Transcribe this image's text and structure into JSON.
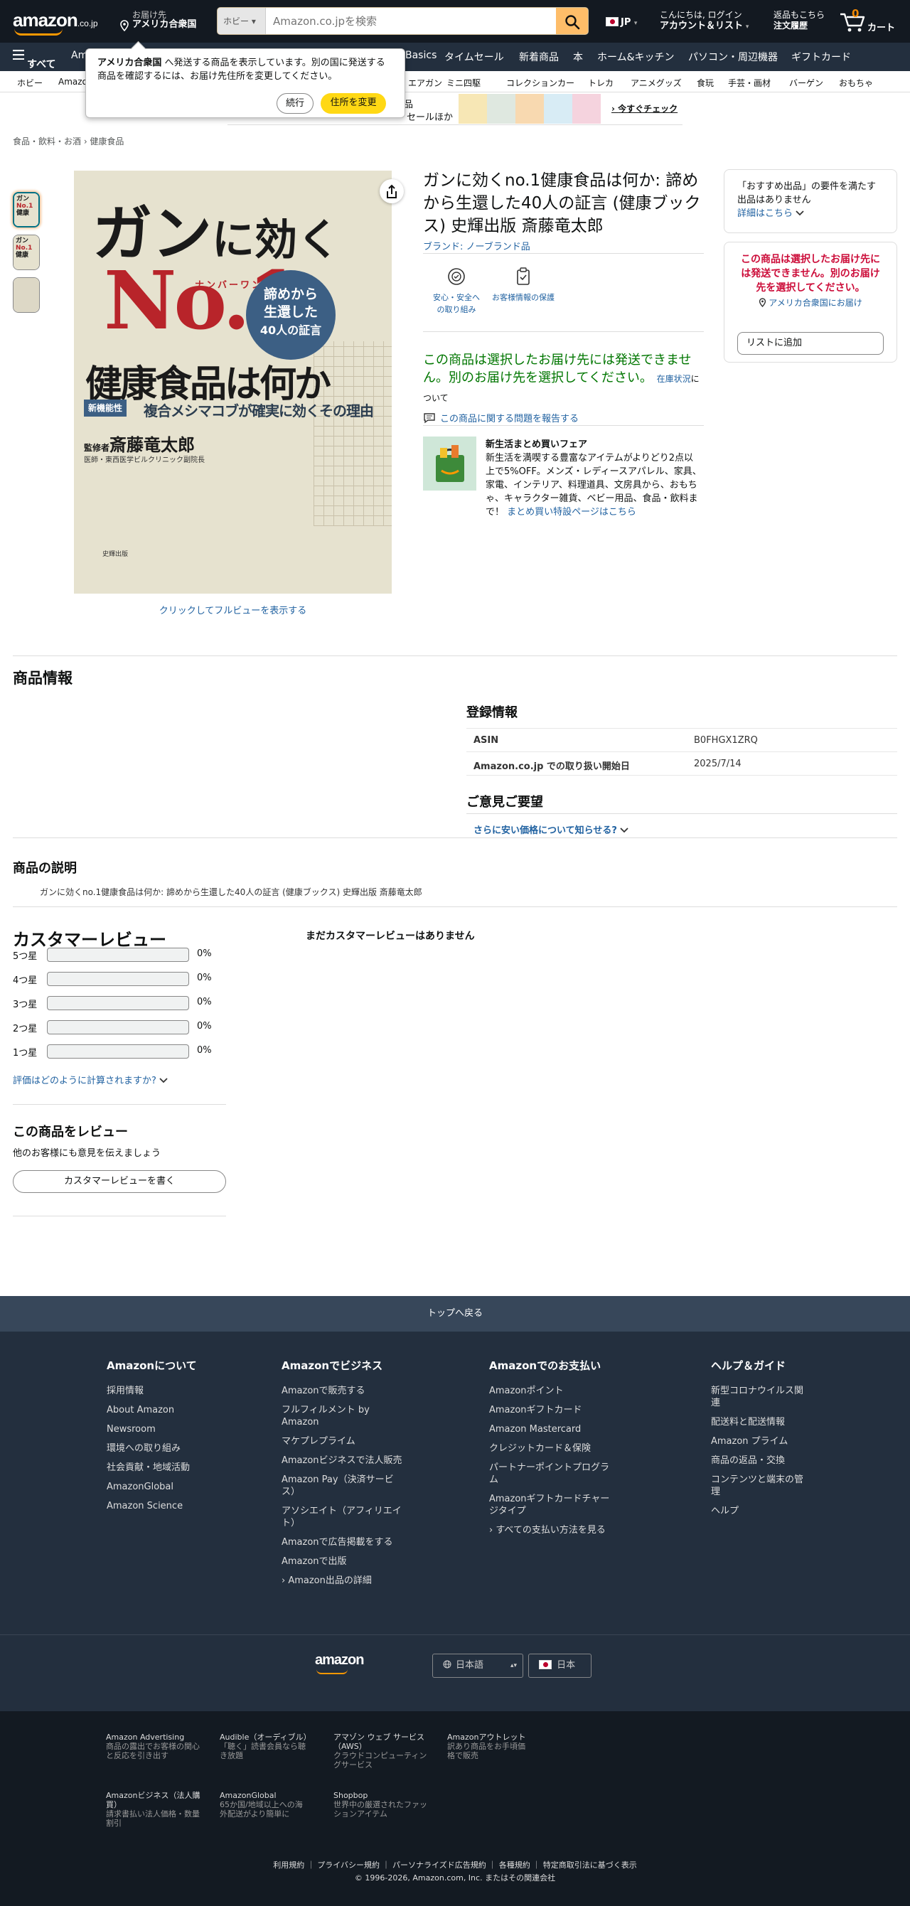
{
  "header": {
    "logo_text": "amazon",
    "logo_suffix": ".co.jp",
    "deliver_label": "お届け先",
    "deliver_to": "アメリカ合衆国",
    "search_category": "ホビー",
    "search_placeholder": "Amazon.co.jpを検索",
    "lang": "JP",
    "account_line1": "こんにちは, ログイン",
    "account_line2": "アカウント＆リスト",
    "orders_line1": "返品もこちら",
    "orders_line2": "注文履歴",
    "cart_count": "0",
    "cart_label": "カート"
  },
  "nav_main": [
    "すべて",
    "Am",
    "Basics",
    "タイムセール",
    "新着商品",
    "本",
    "ホーム&キッチン",
    "パソコン・周辺機器",
    "ギフトカード"
  ],
  "nav_sub": [
    "ホビー",
    "Amazo",
    "エアガン",
    "ミニ四駆",
    "コレクションカー",
    "トレカ",
    "アニメグッズ",
    "食玩",
    "手芸・画材",
    "バーゲン",
    "おもちゃ"
  ],
  "banner": {
    "text_a": "品",
    "text_b": "セールほか",
    "cta": "今すぐチェック"
  },
  "popover": {
    "country": "アメリカ合衆国",
    "text": " へ発送する商品を表示しています。別の国に発送する商品を確認するには、お届け先住所を変更してください。",
    "continue": "続行",
    "change": "住所を変更"
  },
  "breadcrumb": "食品・飲料・お酒 › 健康食品",
  "product": {
    "cover": {
      "title_a": "ガン",
      "title_b": "に効く",
      "ruby": "ナンバーワン",
      "no1": "No.1",
      "title_c": "健康食品は何か",
      "seal": [
        "諦めから",
        "生還した",
        "40人の証言"
      ],
      "tag": "新機能性",
      "sub": "複合メシマコブが確実に効くその理由",
      "sup_label": "監修者",
      "author": "斎藤竜太郎",
      "author_title": "医師・東西医学ビルクリニック副院長",
      "publisher": "史輝出版"
    },
    "title": "ガンに効くno.1健康食品は何か: 諦めから生還した40人の証言 (健康ブックス) 史輝出版 斎藤竜太郎",
    "brand": "ブランド: ノーブランド品",
    "fullview": "クリックしてフルビューを表示する",
    "features": [
      {
        "label": "安心・安全への取り組み"
      },
      {
        "label": "お客様情報の保護"
      }
    ],
    "unavailable": "この商品は選択したお届け先には発送できません。別のお届け先を選択してください。",
    "stock_link": "在庫状況",
    "stock_tail": "について",
    "report": "この商品に関する問題を報告する",
    "fair_title": "新生活まとめ買いフェア",
    "fair_text": "新生活を満喫する豊富なアイテムがよりどり2点以上で5%OFF。メンズ・レディースアパレル、家具、家電、インテリア、料理道具、文房具から、おもちゃ、キャラクター雑貨、ベビー用品、食品・飲料まで！",
    "fair_link": "まとめ買い特設ページはこちら"
  },
  "buybox": {
    "rec_text": "「おすすめ出品」の要件を満たす出品はありません",
    "rec_link": "詳細はこちら",
    "err_text": "この商品は選択したお届け先には発送できません。別のお届け先を選択してください。",
    "loc": "アメリカ合衆国にお届け",
    "list_btn": "リストに追加"
  },
  "info": {
    "heading": "商品情報",
    "reg_heading": "登録情報",
    "rows": [
      {
        "k": "ASIN",
        "v": "B0FHGX1ZRQ"
      },
      {
        "k": "Amazon.co.jp での取り扱い開始日",
        "v": "2025/7/14"
      }
    ],
    "feedback_heading": "ご意見ご要望",
    "feedback_link": "さらに安い価格について知らせる?"
  },
  "description": {
    "heading": "商品の説明",
    "text": "ガンに効くno.1健康食品は何か: 諦めから生還した40人の証言 (健康ブックス) 史輝出版 斎藤竜太郎"
  },
  "reviews": {
    "heading": "カスタマーレビュー",
    "none": "まだカスタマーレビューはありません",
    "rows": [
      {
        "label": "5つ星",
        "pct": "0%"
      },
      {
        "label": "4つ星",
        "pct": "0%"
      },
      {
        "label": "3つ星",
        "pct": "0%"
      },
      {
        "label": "2つ星",
        "pct": "0%"
      },
      {
        "label": "1つ星",
        "pct": "0%"
      }
    ],
    "how": "評価はどのように計算されますか?",
    "write_heading": "この商品をレビュー",
    "write_sub": "他のお客様にも意見を伝えましょう",
    "write_btn": "カスタマーレビューを書く"
  },
  "footer": {
    "back_top": "トップへ戻る",
    "cols": [
      {
        "title": "Amazonについて",
        "items": [
          "採用情報",
          "About Amazon",
          "Newsroom",
          "環境への取り組み",
          "社会貢献・地域活動",
          "AmazonGlobal",
          "Amazon Science"
        ]
      },
      {
        "title": "Amazonでビジネス",
        "items": [
          "Amazonで販売する",
          "フルフィルメント by Amazon",
          "マケプレプライム",
          "Amazonビジネスで法人販売",
          "Amazon Pay（決済サービス）",
          "アソシエイト（アフィリエイト）",
          "Amazonで広告掲載をする",
          "Amazonで出版",
          "› Amazon出品の詳細"
        ]
      },
      {
        "title": "Amazonでのお支払い",
        "items": [
          "Amazonポイント",
          "Amazonギフトカード",
          "Amazon Mastercard",
          "クレジットカード＆保険",
          "パートナーポイントプログラム",
          "Amazonギフトカードチャージタイプ",
          "› すべての支払い方法を見る"
        ]
      },
      {
        "title": "ヘルプ＆ガイド",
        "items": [
          "新型コロナウイルス関連",
          "配送料と配送情報",
          "Amazon プライム",
          "商品の返品・交換",
          "コンテンツと端末の管理",
          "ヘルプ"
        ]
      }
    ],
    "logo": "amazon",
    "language": "日本語",
    "country": "日本",
    "cells": [
      {
        "t": "Amazon Advertising",
        "d": "商品の露出でお客様の関心と反応を引き出す"
      },
      {
        "t": "Audible（オーディブル）",
        "d": "「聴く」読書会員なら聴き放題"
      },
      {
        "t": "アマゾン ウェブ サービス（AWS）",
        "d": "クラウドコンピューティングサービス"
      },
      {
        "t": "Amazonアウトレット",
        "d": "訳あり商品をお手頃価格で販売"
      },
      {
        "t": "Amazonビジネス（法人購買）",
        "d": "請求書払い法人価格・数量割引"
      },
      {
        "t": "AmazonGlobal",
        "d": "65か国/地域以上への海外配送がより簡単に"
      },
      {
        "t": "Shopbop",
        "d": "世界中の厳選されたファッションアイテム"
      }
    ],
    "legal_links": [
      "利用規約",
      "プライバシー規約",
      "パーソナライズド広告規約",
      "各種規約",
      "特定商取引法に基づく表示"
    ],
    "copyright": "© 1996-2026, Amazon.com, Inc. またはその関連会社"
  }
}
